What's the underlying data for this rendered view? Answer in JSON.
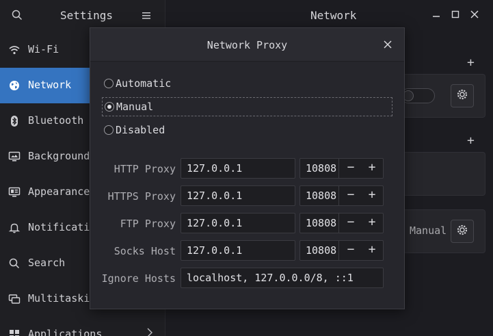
{
  "sidebar": {
    "title": "Settings",
    "items": [
      {
        "label": "Wi-Fi",
        "icon": "wifi-icon"
      },
      {
        "label": "Network",
        "icon": "network-globe-icon",
        "selected": true
      },
      {
        "label": "Bluetooth",
        "icon": "bluetooth-icon"
      },
      {
        "label": "Background",
        "icon": "background-display-icon"
      },
      {
        "label": "Appearance",
        "icon": "appearance-icon"
      },
      {
        "label": "Notifications",
        "icon": "bell-icon"
      },
      {
        "label": "Search",
        "icon": "search-icon"
      },
      {
        "label": "Multitasking",
        "icon": "multitasking-icon"
      },
      {
        "label": "Applications",
        "icon": "applications-icon"
      }
    ]
  },
  "main": {
    "title": "Network",
    "proxy_status": "Manual"
  },
  "dialog": {
    "title": "Network Proxy",
    "options": [
      {
        "label": "Automatic",
        "checked": false
      },
      {
        "label": "Manual",
        "checked": true
      },
      {
        "label": "Disabled",
        "checked": false
      }
    ],
    "proxies": [
      {
        "label": "HTTP Proxy",
        "host": "127.0.0.1",
        "port": "10808"
      },
      {
        "label": "HTTPS Proxy",
        "host": "127.0.0.1",
        "port": "10808"
      },
      {
        "label": "FTP Proxy",
        "host": "127.0.0.1",
        "port": "10808"
      },
      {
        "label": "Socks Host",
        "host": "127.0.0.1",
        "port": "10808"
      }
    ],
    "ignore_hosts": {
      "label": "Ignore Hosts",
      "value": "localhost, 127.0.0.0/8, ::1"
    },
    "stepper": {
      "minus": "−",
      "plus": "+"
    }
  },
  "colors": {
    "accent": "#3574c0",
    "background": "#1c1c21",
    "dialog_bg": "#26262c"
  }
}
